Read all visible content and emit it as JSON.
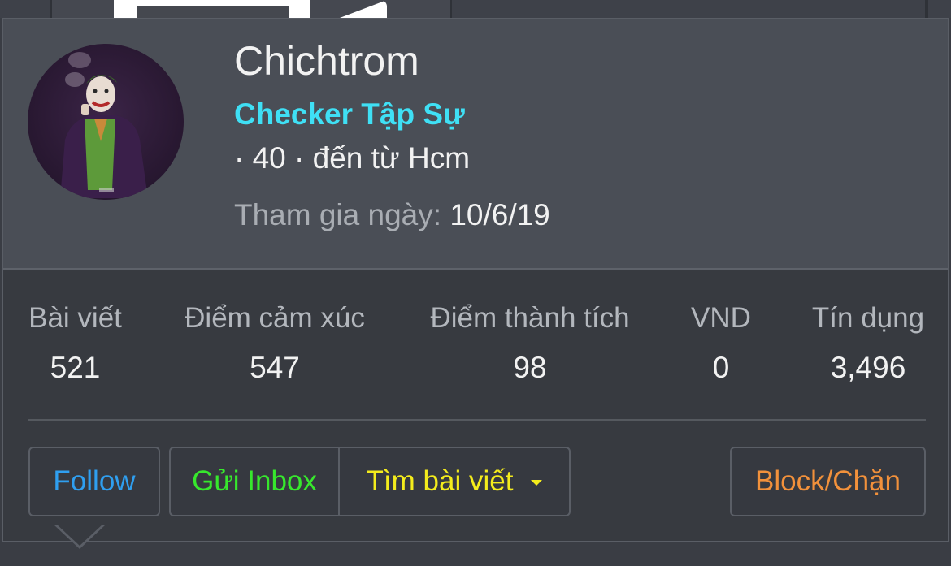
{
  "profile": {
    "username": "Chichtrom",
    "title": "Checker Tập Sự",
    "meta": "· 40 · đến từ Hcm",
    "join_label": "Tham gia ngày:",
    "join_date": "10/6/19",
    "avatar": "avatar-joker-image"
  },
  "stats": [
    {
      "label": "Bài viết",
      "value": "521"
    },
    {
      "label": "Điểm cảm xúc",
      "value": "547"
    },
    {
      "label": "Điểm thành tích",
      "value": "98"
    },
    {
      "label": "VND",
      "value": "0"
    },
    {
      "label": "Tín dụng",
      "value": "3,496"
    }
  ],
  "actions": {
    "follow": "Follow",
    "inbox": "Gửi Inbox",
    "find_posts": "Tìm bài viết",
    "block": "Block/Chặn"
  },
  "colors": {
    "title": "#3fe0f5",
    "follow": "#2f9ff0",
    "inbox": "#37e82d",
    "find_posts": "#f4ec1c",
    "block": "#f2913b"
  }
}
